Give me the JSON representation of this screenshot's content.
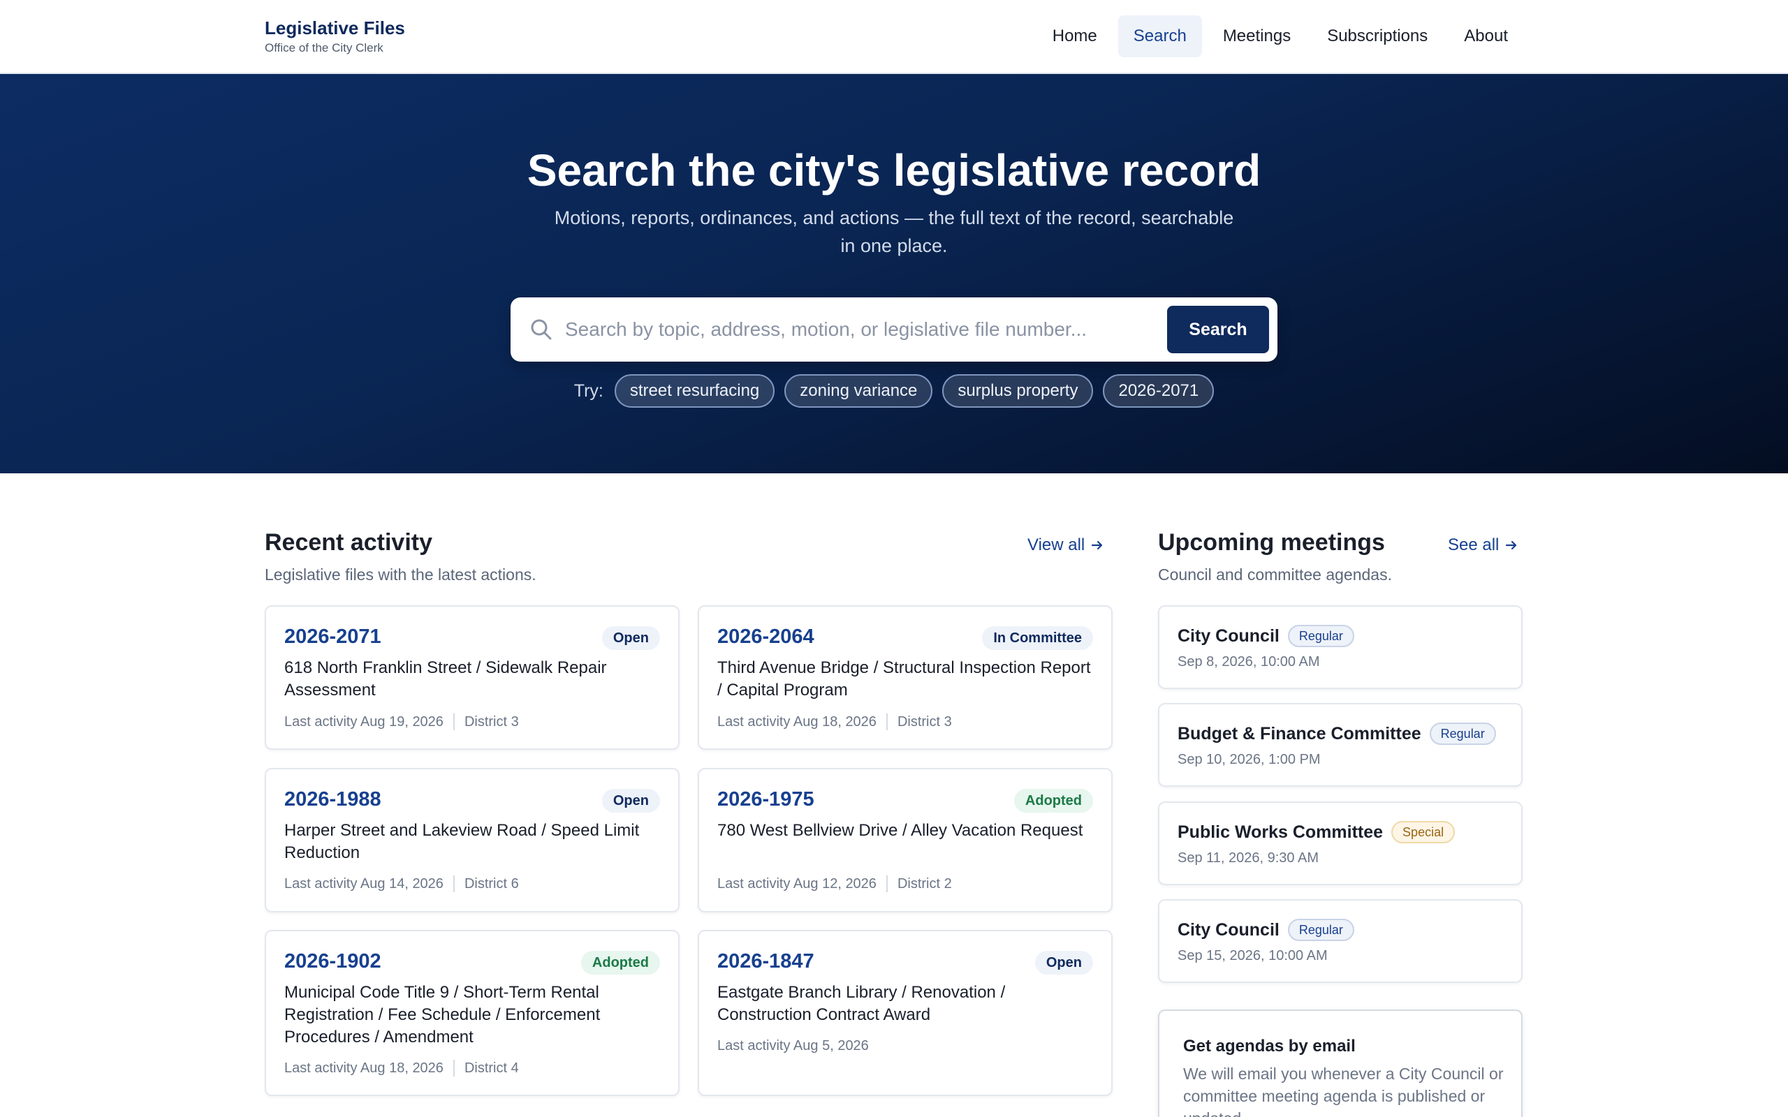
{
  "header": {
    "brand_title": "Legislative Files",
    "brand_subtitle": "Office of the City Clerk",
    "nav": [
      {
        "label": "Home"
      },
      {
        "label": "Search",
        "active": true
      },
      {
        "label": "Meetings"
      },
      {
        "label": "Subscriptions"
      },
      {
        "label": "About"
      }
    ]
  },
  "hero": {
    "title": "Search the city's legislative record",
    "subtitle": "Motions, reports, ordinances, and actions — the full text of the record, searchable in one place.",
    "search_placeholder": "Search by topic, address, motion, or legislative file number...",
    "search_button": "Search",
    "search_icon": "search-icon",
    "try_label": "Try:",
    "suggestions": [
      "street resurfacing",
      "zoning variance",
      "surplus property",
      "2026-2071"
    ]
  },
  "recent": {
    "title": "Recent activity",
    "subtitle": "Legislative files with the latest actions.",
    "link_label": "View all",
    "files": [
      {
        "id": "2026-2071",
        "status": "Open",
        "title": "618 North Franklin Street / Sidewalk Repair Assessment",
        "activity": "Last activity Aug 19, 2026",
        "district": "District 3"
      },
      {
        "id": "2026-2064",
        "status": "In Committee",
        "title": "Third Avenue Bridge / Structural Inspection Report / Capital Program",
        "activity": "Last activity Aug 18, 2026",
        "district": "District 3"
      },
      {
        "id": "2026-1988",
        "status": "Open",
        "title": "Harper Street and Lakeview Road / Speed Limit Reduction",
        "activity": "Last activity Aug 14, 2026",
        "district": "District 6"
      },
      {
        "id": "2026-1975",
        "status": "Adopted",
        "title": "780 West Bellview Drive / Alley Vacation Request",
        "activity": "Last activity Aug 12, 2026",
        "district": "District 2"
      },
      {
        "id": "2026-1902",
        "status": "Adopted",
        "title": "Municipal Code Title 9 / Short-Term Rental Registration / Fee Schedule / Enforcement Procedures / Amendment",
        "activity": "Last activity Aug 18, 2026",
        "district": "District 4"
      },
      {
        "id": "2026-1847",
        "status": "Open",
        "title": "Eastgate Branch Library / Renovation / Construction Contract Award",
        "activity": "Last activity Aug 5, 2026",
        "district": ""
      }
    ]
  },
  "meetings": {
    "title": "Upcoming meetings",
    "subtitle": "Council and committee agendas.",
    "link_label": "See all",
    "items": [
      {
        "name": "City Council",
        "type": "Regular",
        "time": "Sep 8, 2026, 10:00 AM"
      },
      {
        "name": "Budget & Finance Committee",
        "type": "Regular",
        "time": "Sep 10, 2026, 1:00 PM"
      },
      {
        "name": "Public Works Committee",
        "type": "Special",
        "time": "Sep 11, 2026, 9:30 AM"
      },
      {
        "name": "City Council",
        "type": "Regular",
        "time": "Sep 15, 2026, 10:00 AM"
      }
    ]
  },
  "email_signup": {
    "title": "Get agendas by email",
    "body": "We will email you whenever a City Council or committee meeting agenda is published or updated."
  },
  "colors": {
    "brand_navy": "#0f2a5c",
    "link_blue": "#17408f",
    "hero_dark": "#061634",
    "adopted_green": "#1c7a47",
    "special_amber": "#9a6512"
  }
}
